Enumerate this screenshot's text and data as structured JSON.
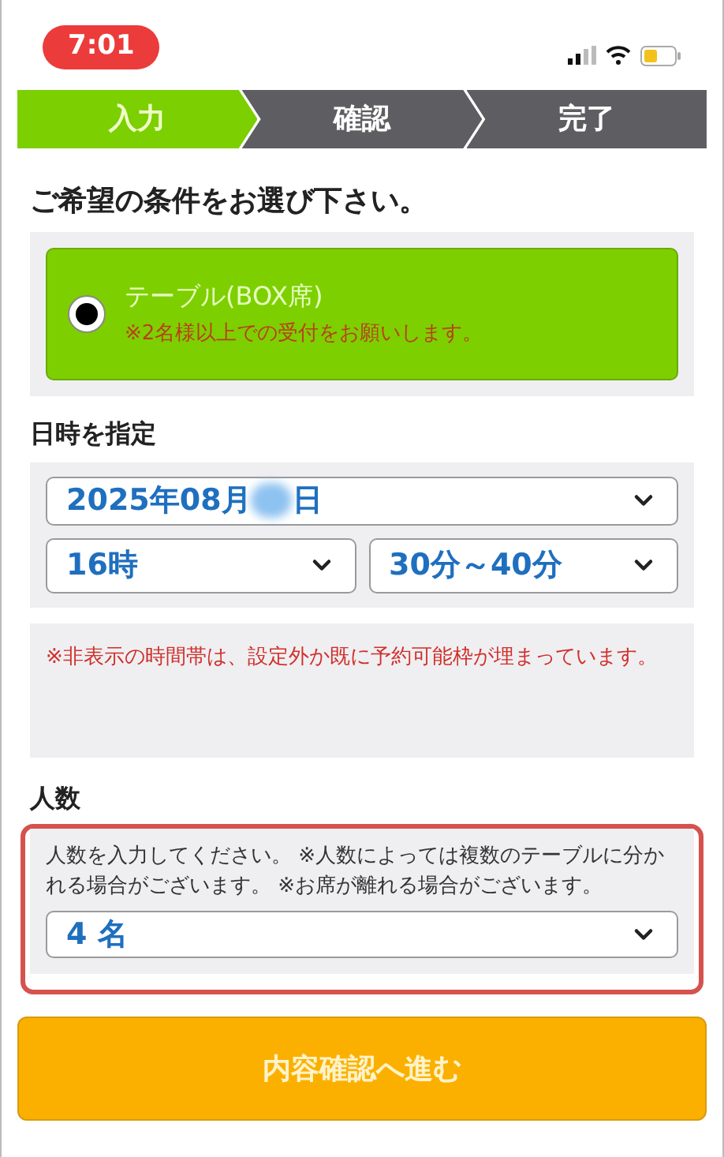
{
  "status_bar": {
    "time": "7:01"
  },
  "steps": [
    {
      "label": "入力",
      "selected": true
    },
    {
      "label": "確認",
      "selected": false
    },
    {
      "label": "完了",
      "selected": false
    }
  ],
  "conditions": {
    "heading": "ご希望の条件をお選び下さい。",
    "options": [
      {
        "label": "テーブル(BOX席)",
        "note": "※2名様以上での受付をお願いします。",
        "selected": true
      }
    ]
  },
  "datetime": {
    "heading": "日時を指定",
    "date_prefix": "2025年08月",
    "date_suffix": "日",
    "hour": "16時",
    "minute": "30分～40分",
    "note": "※非表示の時間帯は、設定外か既に予約可能枠が埋まっています。"
  },
  "people": {
    "heading": "人数",
    "description": "人数を入力してください。 ※人数によっては複数のテーブルに分かれる場合がございます。 ※お席が離れる場合がございます。",
    "value": "4 名",
    "highlighted": true
  },
  "submit": {
    "label": "内容確認へ進む"
  }
}
